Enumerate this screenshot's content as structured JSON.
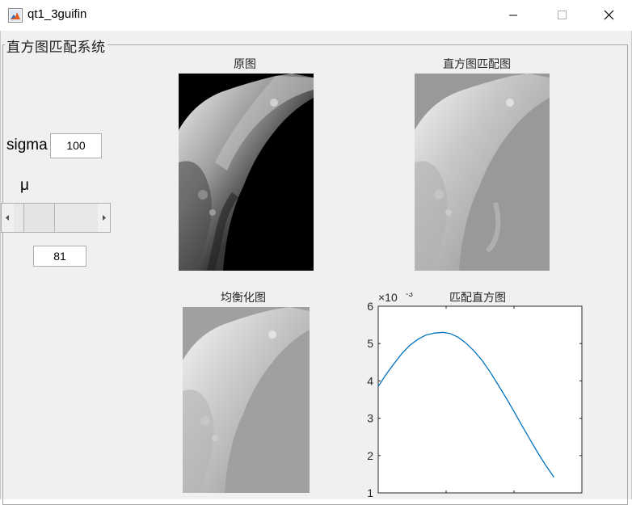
{
  "window": {
    "title": "qt1_3guifin",
    "icon": "matlab-figure-icon",
    "controls": [
      "minimize-icon",
      "maximize-icon",
      "close-icon"
    ]
  },
  "panel": {
    "title": "直方图匹配系统"
  },
  "controls": {
    "sigma_label": "sigma",
    "sigma_value": "100",
    "mu_label": "μ",
    "mu_value": "81",
    "mu_slider_fraction": 0.18
  },
  "axes": {
    "original_title": "原图",
    "matched_title": "直方图匹配图",
    "equalized_title": "均衡化图"
  },
  "chart_data": {
    "type": "line",
    "title": "匹配直方图",
    "exponent_label": "×10",
    "exponent_power": "-3",
    "xlabel": "",
    "ylabel": "",
    "xlim": [
      0,
      255
    ],
    "ylim": [
      1,
      6
    ],
    "y_ticks": [
      "1",
      "2",
      "3",
      "4",
      "5",
      "6"
    ],
    "x_ticks": [
      0,
      85,
      170,
      255
    ],
    "x_tick_labels_visible": false,
    "grid": false,
    "series": [
      {
        "color": "#0072bd",
        "x": [
          0,
          10,
          20,
          30,
          40,
          50,
          60,
          70,
          81,
          90,
          100,
          110,
          120,
          130,
          140,
          150,
          160,
          170,
          180,
          190,
          200,
          210,
          220
        ],
        "values": [
          3.85,
          4.18,
          4.47,
          4.74,
          4.96,
          5.12,
          5.23,
          5.28,
          5.3,
          5.27,
          5.17,
          5.01,
          4.8,
          4.55,
          4.24,
          3.9,
          3.55,
          3.18,
          2.8,
          2.43,
          2.07,
          1.73,
          1.42
        ]
      }
    ]
  }
}
